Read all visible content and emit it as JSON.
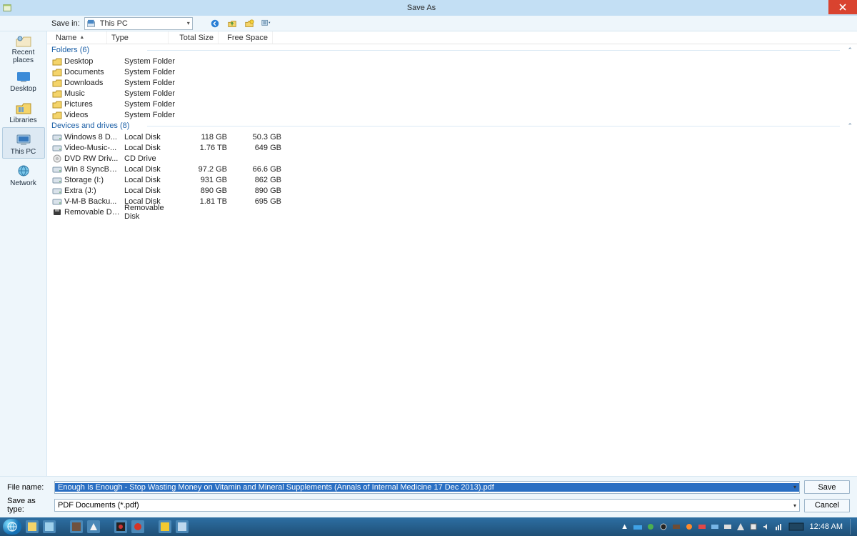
{
  "window": {
    "title": "Save As"
  },
  "toolbar": {
    "savein_label": "Save in:",
    "savein_value": "This PC"
  },
  "places": {
    "items": [
      {
        "label": "Recent places",
        "name": "sidebar-item-recent"
      },
      {
        "label": "Desktop",
        "name": "sidebar-item-desktop"
      },
      {
        "label": "Libraries",
        "name": "sidebar-item-libraries"
      },
      {
        "label": "This PC",
        "name": "sidebar-item-thispc",
        "selected": true
      },
      {
        "label": "Network",
        "name": "sidebar-item-network"
      }
    ]
  },
  "columns": {
    "name": "Name",
    "type": "Type",
    "size": "Total Size",
    "free": "Free Space"
  },
  "groups": {
    "folders_label": "Folders (6)",
    "folders": [
      {
        "name": "Desktop",
        "type": "System Folder"
      },
      {
        "name": "Documents",
        "type": "System Folder"
      },
      {
        "name": "Downloads",
        "type": "System Folder"
      },
      {
        "name": "Music",
        "type": "System Folder"
      },
      {
        "name": "Pictures",
        "type": "System Folder"
      },
      {
        "name": "Videos",
        "type": "System Folder"
      }
    ],
    "drives_label": "Devices and drives (8)",
    "drives": [
      {
        "name": "Windows 8 D...",
        "type": "Local Disk",
        "size": "118 GB",
        "free": "50.3 GB"
      },
      {
        "name": "Video-Music-...",
        "type": "Local Disk",
        "size": "1.76 TB",
        "free": "649 GB"
      },
      {
        "name": "DVD RW Driv...",
        "type": "CD Drive",
        "size": "",
        "free": ""
      },
      {
        "name": "Win 8 SyncBa...",
        "type": "Local Disk",
        "size": "97.2 GB",
        "free": "66.6 GB"
      },
      {
        "name": "Storage (I:)",
        "type": "Local Disk",
        "size": "931 GB",
        "free": "862 GB"
      },
      {
        "name": "Extra (J:)",
        "type": "Local Disk",
        "size": "890 GB",
        "free": "890 GB"
      },
      {
        "name": "V-M-B Backu...",
        "type": "Local Disk",
        "size": "1.81 TB",
        "free": "695 GB"
      },
      {
        "name": "Removable Di...",
        "type": "Removable Disk",
        "size": "",
        "free": ""
      }
    ]
  },
  "bottom": {
    "filename_label": "File name:",
    "filetype_label": "Save as type:",
    "filename_value": "Enough Is Enough - Stop Wasting Money on Vitamin and Mineral Supplements (Annals of Internal Medicine 17 Dec 2013).pdf",
    "filetype_value": "PDF Documents (*.pdf)",
    "save": "Save",
    "cancel": "Cancel"
  },
  "taskbar": {
    "clock": "12:48 AM"
  }
}
